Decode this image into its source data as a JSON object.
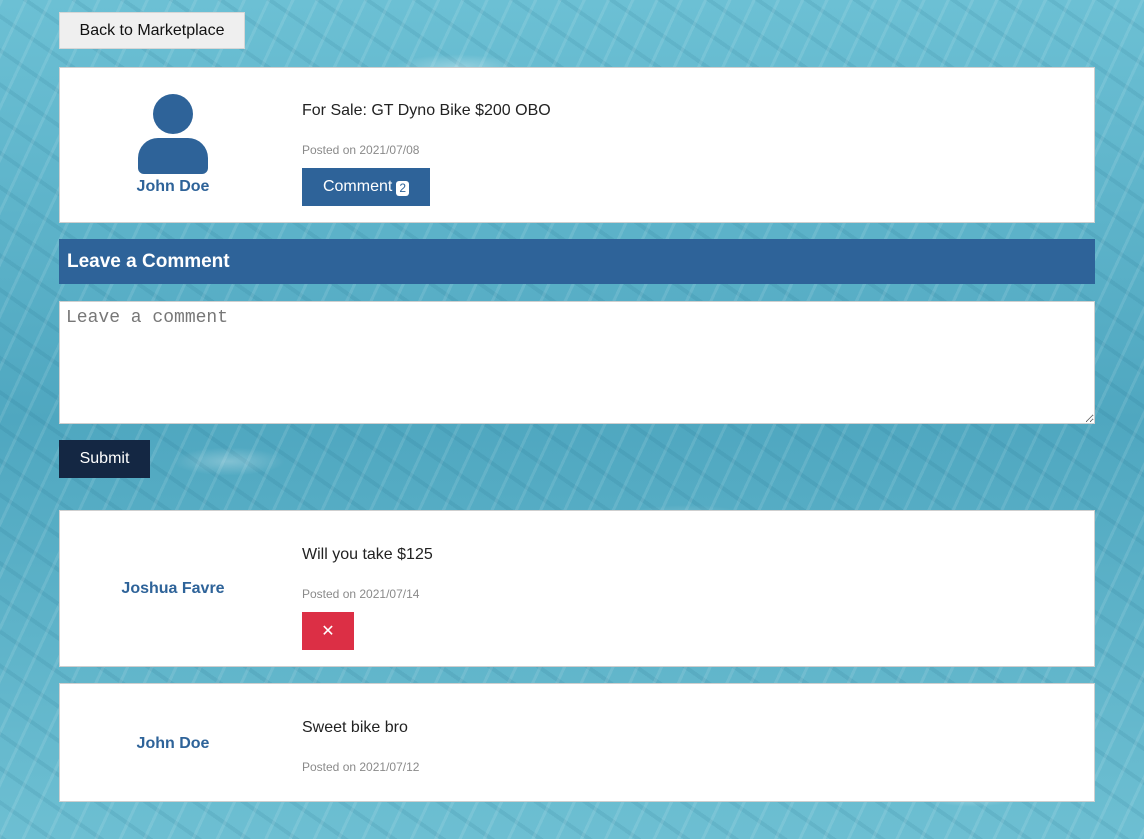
{
  "nav": {
    "back_label": "Back to Marketplace"
  },
  "post": {
    "author": "John Doe",
    "text": "For Sale: GT Dyno Bike $200 OBO",
    "posted_on": "Posted on 2021/07/08",
    "comment_button_label": "Comment",
    "comment_count": "2"
  },
  "comment_form": {
    "header": "Leave a Comment",
    "placeholder": "Leave a comment",
    "value": "",
    "submit_label": "Submit"
  },
  "comments": [
    {
      "author": "Joshua Favre",
      "text": "Will you take $125",
      "posted_on": "Posted on 2021/07/14",
      "delete_glyph": "✕"
    },
    {
      "author": "John Doe",
      "text": "Sweet bike bro",
      "posted_on": "Posted on 2021/07/12"
    }
  ],
  "colors": {
    "primary": "#2e6399",
    "submit": "#142743",
    "danger": "#dc2f45",
    "muted_text": "#8a8a8a"
  },
  "icons": {
    "avatar": "user-avatar-icon",
    "delete": "close-icon"
  }
}
